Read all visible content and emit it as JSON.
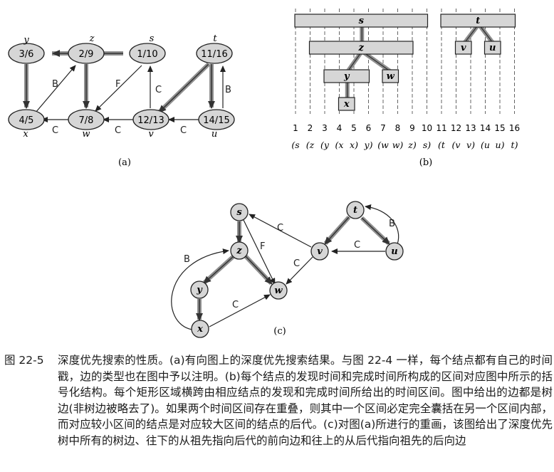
{
  "panel_a": {
    "label": "(a)",
    "nodes": [
      {
        "id": "y",
        "name": "y",
        "times": "3/6"
      },
      {
        "id": "z",
        "name": "z",
        "times": "2/9"
      },
      {
        "id": "s",
        "name": "s",
        "times": "1/10"
      },
      {
        "id": "t",
        "name": "t",
        "times": "11/16"
      },
      {
        "id": "x",
        "name": "x",
        "times": "4/5"
      },
      {
        "id": "w",
        "name": "w",
        "times": "7/8"
      },
      {
        "id": "v",
        "name": "v",
        "times": "12/13"
      },
      {
        "id": "u",
        "name": "u",
        "times": "14/15"
      }
    ],
    "edge_labels": {
      "xz": "B",
      "sw": "F",
      "vs": "C",
      "ut": "B",
      "wx": "C",
      "vw": "C",
      "uv": "C"
    }
  },
  "panel_b": {
    "label": "(b)",
    "ticks": [
      "1",
      "2",
      "3",
      "4",
      "5",
      "6",
      "7",
      "8",
      "9",
      "10",
      "11",
      "12",
      "13",
      "14",
      "15",
      "16"
    ],
    "parens": [
      "(s",
      "(z",
      "(y",
      "(x",
      "x)",
      "y)",
      "(w",
      "w)",
      "z)",
      "s)",
      "(t",
      "(v",
      "v)",
      "(u",
      "u)",
      "t)"
    ],
    "intervals": [
      {
        "name": "s",
        "start": 1,
        "end": 10
      },
      {
        "name": "z",
        "start": 2,
        "end": 9
      },
      {
        "name": "y",
        "start": 3,
        "end": 6
      },
      {
        "name": "x",
        "start": 4,
        "end": 5
      },
      {
        "name": "w",
        "start": 7,
        "end": 8
      },
      {
        "name": "t",
        "start": 11,
        "end": 16
      },
      {
        "name": "v",
        "start": 12,
        "end": 13
      },
      {
        "name": "u",
        "start": 14,
        "end": 15
      }
    ]
  },
  "panel_c": {
    "label": "(c)",
    "nodes": [
      "s",
      "z",
      "y",
      "x",
      "w",
      "t",
      "v",
      "u"
    ],
    "edge_labels": {
      "yx_back": "B",
      "zw": "F",
      "vs": "C",
      "vw": "C",
      "xw": "C",
      "ut_back": "B",
      "uv": "C"
    }
  },
  "caption": {
    "number": "图 22-5",
    "text": "深度优先搜索的性质。(a)有向图上的深度优先搜索结果。与图 22-4 一样，每个结点都有自己的时间戳，边的类型也在图中予以注明。(b)每个结点的发现时间和完成时间所构成的区间对应图中所示的括号化结构。每个矩形区域横跨由相应结点的发现和完成时间所给出的时间区间。图中给出的边都是树边(非树边被略去了)。如果两个时间区间存在重叠，则其中一个区间必定完全囊括在另一个区间内部，而对应较小区间的结点是对应较大区间的结点的后代。(c)对图(a)所进行的重画，该图给出了深度优先树中所有的树边、往下的从祖先指向后代的前向边和往上的从后代指向祖先的后向边"
  },
  "colors": {
    "node_fill": "#d6d6d6",
    "tree_edge": "#9a9a9a",
    "stroke": "#222222"
  }
}
